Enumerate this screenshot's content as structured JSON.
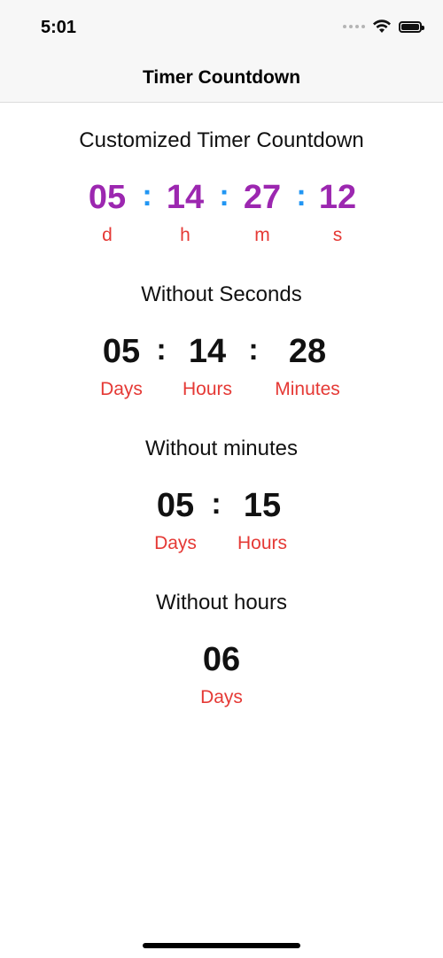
{
  "status_bar": {
    "time": "5:01",
    "icons": [
      "signal-dots-icon",
      "wifi-icon",
      "battery-icon"
    ]
  },
  "nav": {
    "title": "Timer Countdown"
  },
  "sections": {
    "custom": {
      "title": "Customized Timer Countdown",
      "values": [
        "05",
        "14",
        "27",
        "12"
      ],
      "separator": ":",
      "labels": [
        "d",
        "h",
        "m",
        "s"
      ],
      "digit_color": "#9c27b0",
      "separator_color": "#2196f3",
      "label_color": "#e53935"
    },
    "no_seconds": {
      "title": "Without Seconds",
      "values": [
        "05",
        "14",
        "28"
      ],
      "separator": ":",
      "labels": [
        "Days",
        "Hours",
        "Minutes"
      ]
    },
    "no_minutes": {
      "title": "Without minutes",
      "values": [
        "05",
        "15"
      ],
      "separator": ":",
      "labels": [
        "Days",
        "Hours"
      ]
    },
    "no_hours": {
      "title": "Without hours",
      "values": [
        "06"
      ],
      "labels": [
        "Days"
      ]
    }
  }
}
